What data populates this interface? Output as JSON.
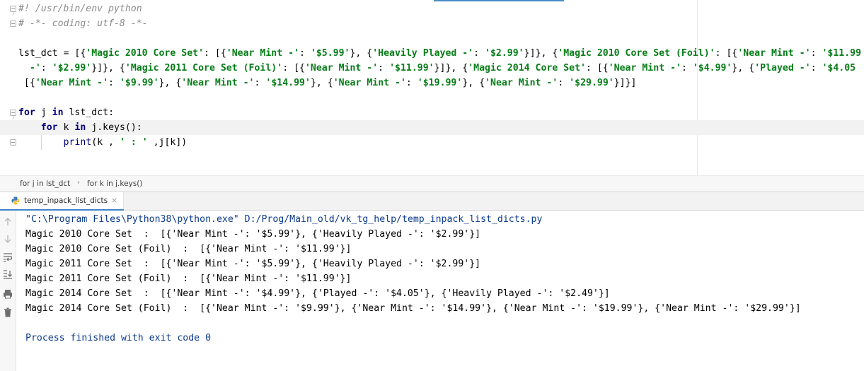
{
  "editor": {
    "lines": [
      {
        "parts": [
          {
            "cls": "cmt",
            "t": "#! /usr/bin/env python"
          }
        ]
      },
      {
        "parts": [
          {
            "cls": "cmt",
            "t": "# -*- coding: utf-8 -*-"
          }
        ]
      },
      {
        "parts": []
      },
      {
        "parts": [
          {
            "cls": "",
            "t": "lst_dct = [{"
          },
          {
            "cls": "str",
            "t": "'Magic 2010 Core Set'"
          },
          {
            "cls": "",
            "t": ": [{"
          },
          {
            "cls": "str",
            "t": "'Near Mint -'"
          },
          {
            "cls": "",
            "t": ": "
          },
          {
            "cls": "str",
            "t": "'$5.99'"
          },
          {
            "cls": "",
            "t": "}, {"
          },
          {
            "cls": "str",
            "t": "'Heavily Played -'"
          },
          {
            "cls": "",
            "t": ": "
          },
          {
            "cls": "str",
            "t": "'$2.99'"
          },
          {
            "cls": "",
            "t": "}]}, {"
          },
          {
            "cls": "str",
            "t": "'Magic 2010 Core Set (Foil)'"
          },
          {
            "cls": "",
            "t": ": [{"
          },
          {
            "cls": "str",
            "t": "'Near Mint -'"
          },
          {
            "cls": "",
            "t": ": "
          },
          {
            "cls": "str",
            "t": "'$11.99"
          }
        ]
      },
      {
        "parts": [
          {
            "cls": "str",
            "t": "  -'"
          },
          {
            "cls": "",
            "t": ": "
          },
          {
            "cls": "str",
            "t": "'$2.99'"
          },
          {
            "cls": "",
            "t": "}]}, {"
          },
          {
            "cls": "str",
            "t": "'Magic 2011 Core Set (Foil)'"
          },
          {
            "cls": "",
            "t": ": [{"
          },
          {
            "cls": "str",
            "t": "'Near Mint -'"
          },
          {
            "cls": "",
            "t": ": "
          },
          {
            "cls": "str",
            "t": "'$11.99'"
          },
          {
            "cls": "",
            "t": "}]}, {"
          },
          {
            "cls": "str",
            "t": "'Magic 2014 Core Set'"
          },
          {
            "cls": "",
            "t": ": [{"
          },
          {
            "cls": "str",
            "t": "'Near Mint -'"
          },
          {
            "cls": "",
            "t": ": "
          },
          {
            "cls": "str",
            "t": "'$4.99'"
          },
          {
            "cls": "",
            "t": "}, {"
          },
          {
            "cls": "str",
            "t": "'Played -'"
          },
          {
            "cls": "",
            "t": ": "
          },
          {
            "cls": "str",
            "t": "'$4.05"
          }
        ]
      },
      {
        "parts": [
          {
            "cls": "",
            "t": " [{"
          },
          {
            "cls": "str",
            "t": "'Near Mint -'"
          },
          {
            "cls": "",
            "t": ": "
          },
          {
            "cls": "str",
            "t": "'$9.99'"
          },
          {
            "cls": "",
            "t": "}, {"
          },
          {
            "cls": "str",
            "t": "'Near Mint -'"
          },
          {
            "cls": "",
            "t": ": "
          },
          {
            "cls": "str",
            "t": "'$14.99'"
          },
          {
            "cls": "",
            "t": "}, {"
          },
          {
            "cls": "str",
            "t": "'Near Mint -'"
          },
          {
            "cls": "",
            "t": ": "
          },
          {
            "cls": "str",
            "t": "'$19.99'"
          },
          {
            "cls": "",
            "t": "}, {"
          },
          {
            "cls": "str",
            "t": "'Near Mint -'"
          },
          {
            "cls": "",
            "t": ": "
          },
          {
            "cls": "str",
            "t": "'$29.99'"
          },
          {
            "cls": "",
            "t": "}]}]"
          }
        ]
      },
      {
        "parts": []
      },
      {
        "parts": [
          {
            "cls": "kw",
            "t": "for"
          },
          {
            "cls": "",
            "t": " j "
          },
          {
            "cls": "kw",
            "t": "in"
          },
          {
            "cls": "",
            "t": " lst_dct:"
          }
        ]
      },
      {
        "parts": [
          {
            "cls": "",
            "t": "    "
          },
          {
            "cls": "kw",
            "t": "for"
          },
          {
            "cls": "",
            "t": " k "
          },
          {
            "cls": "kw",
            "t": "in"
          },
          {
            "cls": "",
            "t": " j.keys():"
          }
        ]
      },
      {
        "parts": [
          {
            "cls": "",
            "t": "        "
          },
          {
            "cls": "bi",
            "t": "print"
          },
          {
            "cls": "",
            "t": "(k , "
          },
          {
            "cls": "str",
            "t": "' : '"
          },
          {
            "cls": "",
            "t": " ,j[k])"
          }
        ]
      }
    ]
  },
  "breadcrumb": {
    "items": [
      "for j in lst_dct",
      "for k in j.keys()"
    ],
    "separator": "›"
  },
  "run": {
    "tab_label": "temp_inpack_list_dicts",
    "close_glyph": "×"
  },
  "console": {
    "command": "\"C:\\Program Files\\Python38\\python.exe\" D:/Prog/Main_old/vk_tg_help/temp_inpack_list_dicts.py",
    "output": [
      "Magic 2010 Core Set  :  [{'Near Mint -': '$5.99'}, {'Heavily Played -': '$2.99'}]",
      "Magic 2010 Core Set (Foil)  :  [{'Near Mint -': '$11.99'}]",
      "Magic 2011 Core Set  :  [{'Near Mint -': '$5.99'}, {'Heavily Played -': '$2.99'}]",
      "Magic 2011 Core Set (Foil)  :  [{'Near Mint -': '$11.99'}]",
      "Magic 2014 Core Set  :  [{'Near Mint -': '$4.99'}, {'Played -': '$4.05'}, {'Heavily Played -': '$2.49'}]",
      "Magic 2014 Core Set (Foil)  :  [{'Near Mint -': '$9.99'}, {'Near Mint -': '$14.99'}, {'Near Mint -': '$19.99'}, {'Near Mint -': '$29.99'}]"
    ],
    "finished": "Process finished with exit code 0"
  },
  "icons": {
    "run_tab": "python-icon",
    "toolbar": [
      "arrow-up-icon",
      "arrow-down-icon",
      "soft-wrap-icon",
      "scroll-to-end-icon",
      "print-icon",
      "trash-icon"
    ]
  },
  "colors": {
    "keyword": "#000080",
    "string": "#067d17",
    "comment": "#8c8c8c",
    "console_system": "#0b3a8c",
    "tab_accent": "#4083c9"
  }
}
